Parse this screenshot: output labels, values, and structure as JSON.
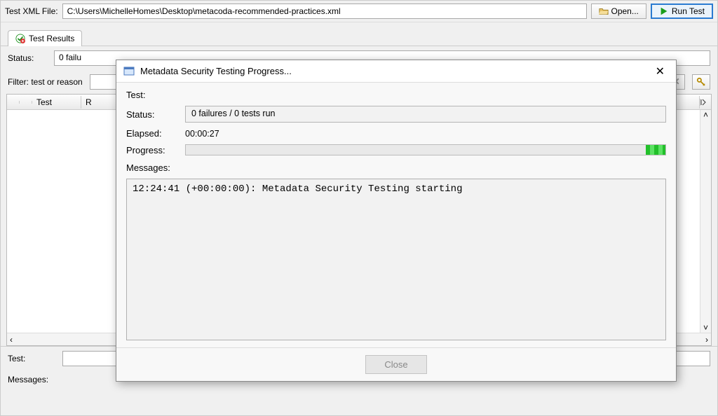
{
  "toolbar": {
    "file_label": "Test XML File:",
    "file_path": "C:\\Users\\MichelleHomes\\Desktop\\metacoda-recommended-practices.xml",
    "open_label": "Open...",
    "run_label": "Run Test"
  },
  "tabs": {
    "results_label": "Test Results"
  },
  "status_row": {
    "label": "Status:",
    "value": "0 failu"
  },
  "filter_row": {
    "label": "Filter: test or reason"
  },
  "table": {
    "col_test": "Test",
    "col_reason_initial": "R"
  },
  "footer": {
    "test_label": "Test:",
    "messages_label": "Messages:"
  },
  "dialog": {
    "title": "Metadata Security Testing Progress...",
    "test_label": "Test:",
    "test_value": "",
    "status_label": "Status:",
    "status_value": "0 failures / 0 tests run",
    "elapsed_label": "Elapsed:",
    "elapsed_value": "00:00:27",
    "progress_label": "Progress:",
    "messages_label": "Messages:",
    "messages_text": "12:24:41 (+00:00:00): Metadata Security Testing starting",
    "close_label": "Close"
  }
}
